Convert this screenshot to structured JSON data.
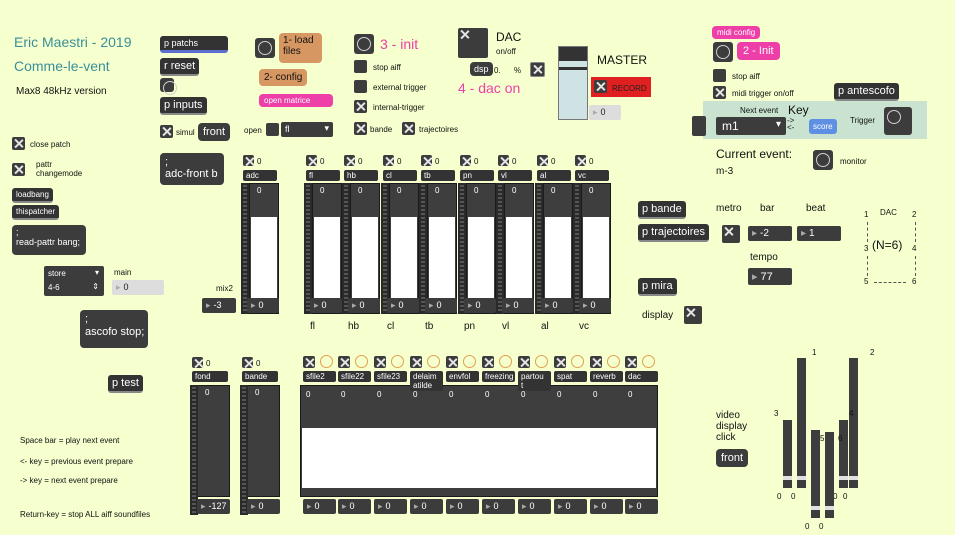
{
  "header": {
    "author": "Eric Maestri - 2019",
    "piece": "Comme-le-vent",
    "version": "Max8 48kHz version"
  },
  "top": {
    "p_patchs": "p patchs",
    "r_reset": "r reset",
    "p_inputs": "p inputs",
    "simul": "simul",
    "front": "front",
    "load_files": "1- load files",
    "config": "2- config",
    "open_matrice": "open matrice",
    "open": "open",
    "open_select": "fl",
    "init_label": "3 - init",
    "stop_aiff": "stop aiff",
    "external_trigger": "external trigger",
    "internal_trigger": "internal-trigger",
    "bande": "bande",
    "trajectoires": "trajectoires",
    "dac_label": "DAC",
    "dac_onoff": "on/off",
    "dsp": "dsp",
    "dsp_value": "0.",
    "percent": "%",
    "dac_on": "4 - dac on",
    "master": "MASTER",
    "record": "RECORD",
    "master_value": "0"
  },
  "left": {
    "close_patch": "close patch",
    "pattr": "pattr changemode",
    "loadbang": "loadbang",
    "thispatcher": "thispatcher",
    "readpattr": ";\nread-pattr bang;",
    "store": "store",
    "store_value": "4-6",
    "main": "main",
    "main_value": "0",
    "ascofo_stop": ";\nascofo stop;",
    "p_test": "p test",
    "adc_front": ";\nadc-front b",
    "mix2": "mix2",
    "mix2_value": "-3"
  },
  "help": {
    "line1": "Space bar = play next event",
    "line2": "<- key = previous event prepare",
    "line3": "-> key = next event prepare",
    "line4": "Return-key = stop ALL aiff soundfiles"
  },
  "mixer_top": {
    "channels": [
      {
        "name": "adc",
        "toggle": "0",
        "value": "0",
        "bottom": "0",
        "label": ""
      },
      {
        "name": "fl",
        "toggle": "0",
        "value": "0",
        "bottom": "0",
        "label": "fl"
      },
      {
        "name": "hb",
        "toggle": "0",
        "value": "0",
        "bottom": "0",
        "label": "hb"
      },
      {
        "name": "cl",
        "toggle": "0",
        "value": "0",
        "bottom": "0",
        "label": "cl"
      },
      {
        "name": "tb",
        "toggle": "0",
        "value": "0",
        "bottom": "0",
        "label": "tb"
      },
      {
        "name": "pn",
        "toggle": "0",
        "value": "0",
        "bottom": "0",
        "label": "pn"
      },
      {
        "name": "vl",
        "toggle": "0",
        "value": "0",
        "bottom": "0",
        "label": "vl"
      },
      {
        "name": "al",
        "toggle": "0",
        "value": "0",
        "bottom": "0",
        "label": "al"
      },
      {
        "name": "vc",
        "toggle": "0",
        "value": "0",
        "bottom": "0",
        "label": "vc"
      }
    ]
  },
  "mixer_bottom": {
    "fond": {
      "name": "fond",
      "toggle": "0",
      "value": "0",
      "bottom": "-127"
    },
    "bande": {
      "name": "bande",
      "toggle": "0",
      "value": "0",
      "bottom": "0"
    },
    "channels": [
      {
        "name": "sfile2",
        "value": "0",
        "bottom": "0"
      },
      {
        "name": "sfile22",
        "value": "0",
        "bottom": "0"
      },
      {
        "name": "sfile23",
        "value": "0",
        "bottom": "0"
      },
      {
        "name": "delaim atilde",
        "value": "0",
        "bottom": "0"
      },
      {
        "name": "envfol",
        "value": "0",
        "bottom": "0"
      },
      {
        "name": "freezing",
        "value": "0",
        "bottom": "0"
      },
      {
        "name": "partou t",
        "value": "0",
        "bottom": "0"
      },
      {
        "name": "spat",
        "value": "0",
        "bottom": "0"
      },
      {
        "name": "reverb",
        "value": "0",
        "bottom": "0"
      },
      {
        "name": "dac",
        "value": "0",
        "bottom": "0"
      }
    ]
  },
  "right": {
    "midi_config": "midi config",
    "init2": "2 - Init",
    "stop_aiff": "stop aiff",
    "midi_trigger": "midi trigger on/off",
    "antescofo": "p antescofo",
    "next_event": "Next event",
    "key": "Key",
    "arrows": "->\n<-",
    "event_value": "m1",
    "score": "score",
    "trigger": "Trigger",
    "current_event_label": "Current event:",
    "current_event": "m-3",
    "monitor": "monitor",
    "p_bande": "p bande",
    "p_trajectoires": "p trajectoires",
    "p_mira": "p mira",
    "display": "display",
    "metro": "metro",
    "bar": "bar",
    "beat": "beat",
    "bar_value": "-2",
    "beat_value": "1",
    "tempo": "tempo",
    "tempo_value": "77",
    "dac_diagram": {
      "title": "DAC",
      "n": "(N=6)",
      "c1": "1",
      "c2": "2",
      "c3": "3",
      "c4": "4",
      "c5": "5",
      "c6": "6"
    },
    "video": "video\ndisplay\nclick",
    "video_front": "front",
    "sliders": [
      {
        "top": "1",
        "bottom": "0",
        "level": 0.0
      },
      {
        "top": "2",
        "bottom": "0",
        "level": 0.0
      },
      {
        "top": "3",
        "bottom": "0",
        "level": 0.0
      },
      {
        "top": "4",
        "bottom": "0",
        "level": 0.0
      },
      {
        "top": "5",
        "bottom": "0",
        "level": 0.0
      },
      {
        "top": "6",
        "bottom": "0",
        "level": 0.0
      }
    ]
  }
}
